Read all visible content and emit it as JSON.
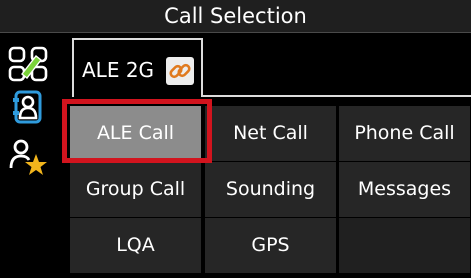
{
  "title": "Call Selection",
  "sidebar": {
    "items": [
      {
        "icon": "antenna-signal-icon"
      },
      {
        "icon": "contact-card-icon"
      },
      {
        "icon": "favorite-contact-icon"
      }
    ]
  },
  "tabs": [
    {
      "label": "ALE 2G",
      "icon": "link-icon",
      "active": true
    }
  ],
  "grid": {
    "selected_index": 0,
    "buttons": [
      {
        "label": "ALE Call"
      },
      {
        "label": "Net Call"
      },
      {
        "label": "Phone Call"
      },
      {
        "label": "Group Call"
      },
      {
        "label": "Sounding"
      },
      {
        "label": "Messages"
      },
      {
        "label": "LQA"
      },
      {
        "label": "GPS"
      },
      {
        "label": ""
      }
    ]
  },
  "colors": {
    "selection_outline": "#d2141e",
    "selected_button": "#8c8c8c",
    "button": "#262626",
    "link_icon": "#e07a1e",
    "star": "#f2b51c"
  }
}
